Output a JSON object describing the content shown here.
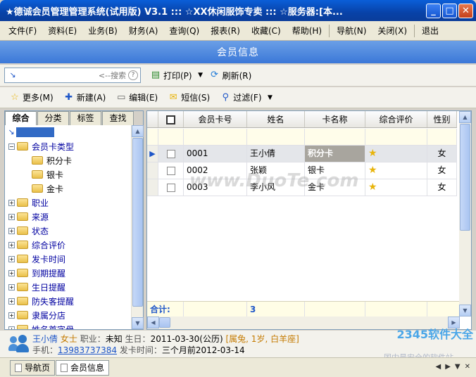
{
  "window": {
    "title": "★德诚会员管理管理系统(试用版) V3.1  :::  ☆XX休闲服饰专卖  :::  ☆服务器:[本...",
    "min": "_",
    "max": "□",
    "close": "✕"
  },
  "menu": {
    "items": [
      "文件(F)",
      "资料(E)",
      "业务(B)",
      "财务(A)",
      "查询(Q)",
      "报表(R)",
      "收藏(C)",
      "帮助(H)"
    ],
    "items2": [
      "导航(N)",
      "关闭(X)"
    ],
    "exit": "退出"
  },
  "banner": {
    "title": "会员信息"
  },
  "toolbar1": {
    "search_placeholder": "<--搜索",
    "help": "?",
    "print": "打印(P)",
    "refresh": "刷新(R)"
  },
  "toolbar2": {
    "more": "更多(M)",
    "new": "新建(A)",
    "edit": "编辑(E)",
    "sms": "短信(S)",
    "filter": "过滤(F)"
  },
  "left_tabs": [
    "综合",
    "分类",
    "标签",
    "查找"
  ],
  "tree": {
    "card_type": "会员卡类型",
    "cards": [
      "积分卡",
      "银卡",
      "金卡"
    ],
    "nodes": [
      "职业",
      "来源",
      "状态",
      "综合评价",
      "发卡时间",
      "到期提醒",
      "生日提醒",
      "防失客提醒",
      "隶属分店",
      "姓名首字母"
    ]
  },
  "grid": {
    "headers": [
      "会员卡号",
      "姓名",
      "卡名称",
      "综合评价",
      "性别"
    ],
    "rows": [
      {
        "card_no": "0001",
        "name": "王小倩",
        "card_name": "积分卡",
        "gender": "女"
      },
      {
        "card_no": "0002",
        "name": "张颖",
        "card_name": "银卡",
        "gender": "女"
      },
      {
        "card_no": "0003",
        "name": "李小风",
        "card_name": "金卡",
        "gender": "女"
      }
    ],
    "star": "★",
    "total_label": "合计:",
    "total_value": "3",
    "watermark": "www.DuoTe.com"
  },
  "info": {
    "name": "王小倩",
    "title": "女士",
    "job_label": "职业：",
    "job": "未知",
    "birth_label": "生日：",
    "birth": "2011-03-30(公历)",
    "zodiac": "[属兔, 1岁, 白羊座]",
    "phone_label": "手机：",
    "phone": "13983737384",
    "issue_label": "发卡时间：",
    "issue": "三个月前2012-03-14"
  },
  "bottom_tabs": [
    "导航页",
    "会员信息"
  ],
  "watermark2": {
    "brand": "2345软件大全",
    "slogan": "国内最安全的软件站"
  }
}
